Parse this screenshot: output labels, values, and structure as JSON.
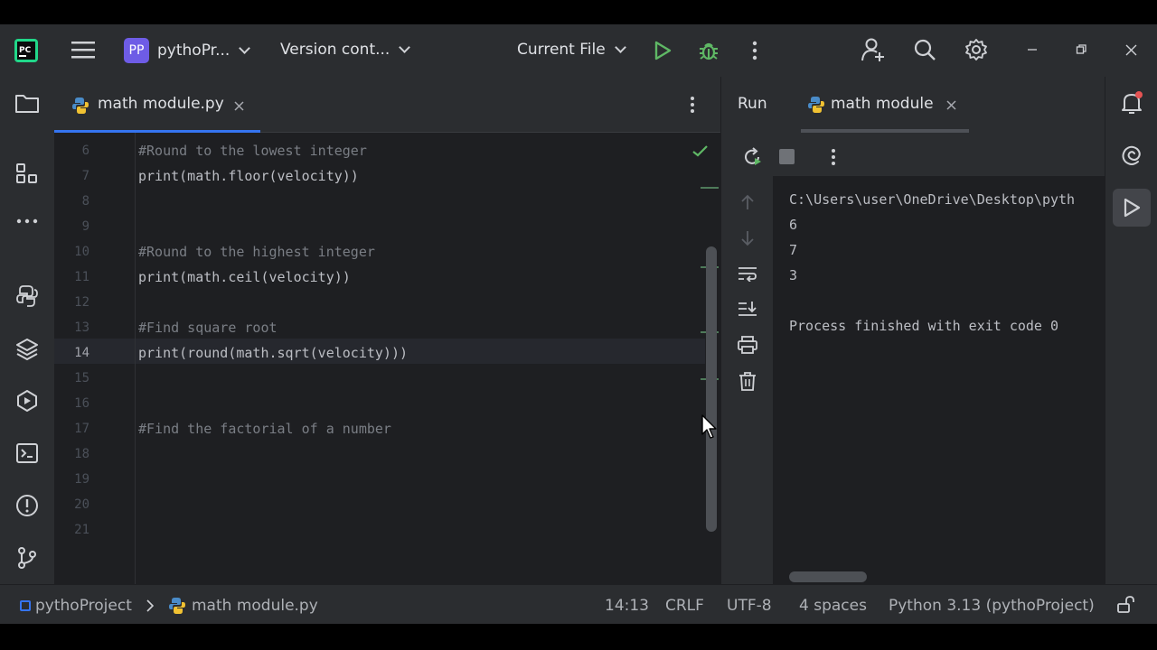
{
  "topbar": {
    "project_badge": "PP",
    "project_name": "pythoPr...",
    "vcs_label": "Version cont...",
    "run_config": "Current File"
  },
  "editor": {
    "tab_label": "math module.py",
    "lines": [
      {
        "num": "6",
        "text": "#Round to the lowest integer"
      },
      {
        "num": "7",
        "text": "print(math.floor(velocity))"
      },
      {
        "num": "8",
        "text": ""
      },
      {
        "num": "9",
        "text": ""
      },
      {
        "num": "10",
        "text": "#Round to the highest integer"
      },
      {
        "num": "11",
        "text": "print(math.ceil(velocity))"
      },
      {
        "num": "12",
        "text": ""
      },
      {
        "num": "13",
        "text": "#Find square root"
      },
      {
        "num": "14",
        "text": "print(round(math.sqrt(velocity)))"
      },
      {
        "num": "15",
        "text": ""
      },
      {
        "num": "16",
        "text": ""
      },
      {
        "num": "17",
        "text": "#Find the factorial of a number"
      },
      {
        "num": "18",
        "text": ""
      },
      {
        "num": "19",
        "text": ""
      },
      {
        "num": "20",
        "text": ""
      },
      {
        "num": "21",
        "text": ""
      }
    ]
  },
  "run": {
    "title": "Run",
    "tab_label": "math module",
    "output": [
      "C:\\Users\\user\\OneDrive\\Desktop\\pyth",
      "6",
      "7",
      "3",
      "",
      "Process finished with exit code 0"
    ]
  },
  "status": {
    "project": "pythoProject",
    "file": "math module.py",
    "position": "14:13",
    "line_sep": "CRLF",
    "encoding": "UTF-8",
    "indent": "4 spaces",
    "interpreter": "Python 3.13 (pythoProject)"
  },
  "colors": {
    "accent": "#3574f0",
    "run_green": "#5fb865",
    "badge_purple": "#6e5ce6"
  }
}
